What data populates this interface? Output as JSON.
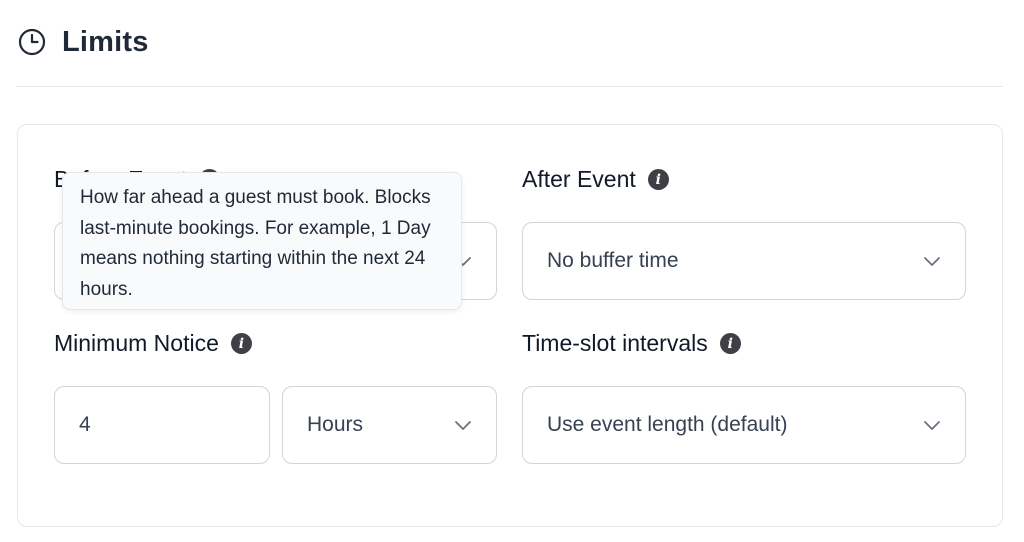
{
  "header": {
    "title": "Limits",
    "icon": "clock-icon"
  },
  "tooltip": {
    "text": "How far ahead a guest must book. Blocks last-minute bookings. For example, 1 Day means nothing starting within the next 24 hours."
  },
  "before_event": {
    "label": "Before Event"
  },
  "after_event": {
    "label": "After Event",
    "value": "No buffer time"
  },
  "minimum_notice": {
    "label": "Minimum Notice",
    "amount": "4",
    "unit": "Hours"
  },
  "time_slot_intervals": {
    "label": "Time-slot intervals",
    "value": "Use event length (default)"
  },
  "colors": {
    "info_icon_bg": "#3f3f46",
    "border": "#d1d5db",
    "tooltip_bg": "#f9fafb"
  }
}
